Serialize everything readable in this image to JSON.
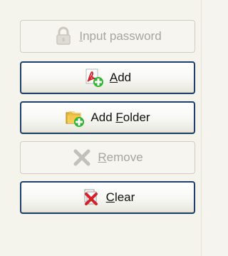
{
  "buttons": [
    {
      "id": "input-password",
      "icon": "padlock-icon",
      "before": "",
      "mnemonic": "I",
      "after": "nput password",
      "enabled": false
    },
    {
      "id": "add",
      "icon": "pdf-add-icon",
      "before": "",
      "mnemonic": "A",
      "after": "dd",
      "enabled": true
    },
    {
      "id": "add-folder",
      "icon": "folder-add-icon",
      "before": "Add ",
      "mnemonic": "F",
      "after": "older",
      "enabled": true
    },
    {
      "id": "remove",
      "icon": "remove-x-icon",
      "before": "",
      "mnemonic": "R",
      "after": "emove",
      "enabled": false
    },
    {
      "id": "clear",
      "icon": "clear-icon",
      "before": "",
      "mnemonic": "C",
      "after": "lear",
      "enabled": true
    }
  ],
  "colors": {
    "enabled_border": "#1d3f6a",
    "disabled_text": "#a7a5a0",
    "accent_green": "#2fb52f",
    "acrobat_red": "#d4212a"
  }
}
